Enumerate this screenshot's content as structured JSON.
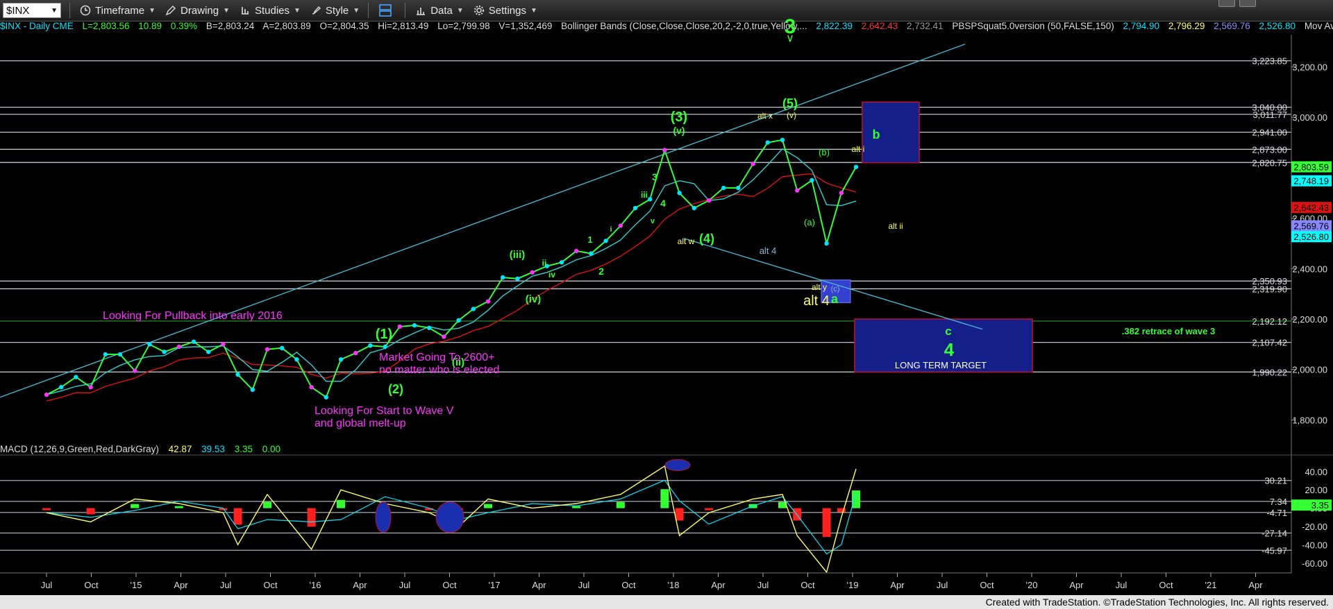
{
  "toolbar": {
    "symbol": "$INX",
    "timeframe": "Timeframe",
    "drawing": "Drawing",
    "studies": "Studies",
    "style": "Style",
    "data": "Data",
    "settings": "Settings"
  },
  "info": {
    "symbol_line": "$INX - Daily  CME",
    "last": "L=2,803.56",
    "change": "10.89",
    "pct": "0.39%",
    "bid": "B=2,803.24",
    "ask": "A=2,803.89",
    "open": "O=2,804.35",
    "high": "Hi=2,813.49",
    "low": "Lo=2,799.98",
    "volume": "V=1,352,469",
    "bb_label": "Bollinger Bands (Close,Close,Close,20,2,-2,0,true,Yellow,...",
    "bb_upper": "2,822.39",
    "bb_lower": "2,642.43",
    "bb_mid": "2,732.41",
    "pbsp_label": "PBSPSquat5.0version (50,FALSE,150)",
    "pbsp_1": "2,794.90",
    "pbsp_2": "2,796.29",
    "pbsp_3": "2,569.76",
    "pbsp_4": "2,526.80",
    "mov_av": "Mov Av..."
  },
  "macd_info": {
    "label": "MACD (12,26,9,Green,Red,DarkGray)",
    "macd": "42.87",
    "signal": "39.53",
    "hist": "3.35",
    "zero": "0.00"
  },
  "footer": "Created with TradeStation. ©TradeStation Technologies, Inc. All rights reserved.",
  "colors": {
    "price_green": "#33ff33",
    "cyan": "#00ffff",
    "red": "#d11",
    "yellow": "#ffff66",
    "magenta": "#ff33ff",
    "navy": "#000080"
  },
  "chart_data": [
    {
      "type": "line",
      "title": "$INX - Daily",
      "ylim": [
        1760,
        3300
      ],
      "y_ticks": [
        "3,200.00",
        "3,000.00",
        "2,800.00",
        "2,600.00",
        "2,400.00",
        "2,200.00",
        "2,000.00",
        "1,800.00"
      ],
      "x_ticks": [
        "Jul",
        "Oct",
        "'15",
        "Apr",
        "Jul",
        "Oct",
        "'16",
        "Apr",
        "Jul",
        "Oct",
        "'17",
        "Apr",
        "Jul",
        "Oct",
        "'18",
        "Apr",
        "Jul",
        "Oct",
        "'19",
        "Apr",
        "Jul",
        "Oct",
        "'20",
        "Apr",
        "Jul",
        "Oct",
        "'21",
        "Apr"
      ],
      "series": [
        {
          "name": "$INX",
          "x": [
            "2014-07",
            "2014-08",
            "2014-09",
            "2014-10",
            "2014-11",
            "2014-12",
            "2015-01",
            "2015-02",
            "2015-03",
            "2015-04",
            "2015-05",
            "2015-06",
            "2015-07",
            "2015-08",
            "2015-09",
            "2015-10",
            "2015-11",
            "2015-12",
            "2016-01",
            "2016-02",
            "2016-03",
            "2016-04",
            "2016-05",
            "2016-06",
            "2016-07",
            "2016-08",
            "2016-09",
            "2016-10",
            "2016-11",
            "2016-12",
            "2017-01",
            "2017-02",
            "2017-03",
            "2017-04",
            "2017-05",
            "2017-06",
            "2017-07",
            "2017-08",
            "2017-09",
            "2017-10",
            "2017-11",
            "2017-12",
            "2018-01",
            "2018-02",
            "2018-03",
            "2018-04",
            "2018-05",
            "2018-06",
            "2018-07",
            "2018-08",
            "2018-09",
            "2018-10",
            "2018-11",
            "2018-12",
            "2019-01",
            "2019-02"
          ],
          "values": [
            1900,
            1930,
            1970,
            1930,
            2060,
            2060,
            1995,
            2100,
            2070,
            2090,
            2110,
            2070,
            2100,
            1980,
            1920,
            2080,
            2085,
            2040,
            1930,
            1890,
            2040,
            2065,
            2095,
            2090,
            2170,
            2175,
            2165,
            2130,
            2195,
            2240,
            2270,
            2365,
            2360,
            2385,
            2410,
            2425,
            2470,
            2460,
            2510,
            2570,
            2640,
            2675,
            2870,
            2700,
            2640,
            2670,
            2720,
            2720,
            2815,
            2900,
            2910,
            2710,
            2750,
            2500,
            2700,
            2803
          ]
        }
      ],
      "horizontal_levels": [
        "3,223.85",
        "3,040.00",
        "3,011.77",
        "2,941.00",
        "2,873.00",
        "2,820.75",
        "2,350.93",
        "2,319.90",
        "2,192.12",
        "2,107.42",
        "1,990.22"
      ],
      "right_labels": [
        {
          "text": "2,803.59",
          "color": "#33ff33"
        },
        {
          "text": "2,748.19",
          "color": "#00ffff"
        },
        {
          "text": "2,642.43",
          "color": "#d11"
        },
        {
          "text": "2,569.76",
          "color": "#8888ff"
        },
        {
          "text": "2,526.80",
          "color": "#00ffff"
        }
      ],
      "annotations": [
        {
          "text": "3",
          "color": "#33ff33"
        },
        {
          "text": "(5)",
          "color": "#33ff33"
        },
        {
          "text": "(3)",
          "color": "#33ff33"
        },
        {
          "text": "(v)",
          "color": "#33ff33"
        },
        {
          "text": "(v)",
          "color": "#ffff66"
        },
        {
          "text": "alt x",
          "color": "#ffff66"
        },
        {
          "text": "(4)",
          "color": "#33ff33"
        },
        {
          "text": "alt w",
          "color": "#ffff66"
        },
        {
          "text": "alt 4",
          "color": "#8fb6d9"
        },
        {
          "text": "alt y",
          "color": "#ffff66"
        },
        {
          "text": "alt 4",
          "color": "#ffff66"
        },
        {
          "text": "a",
          "color": "#33ff33"
        },
        {
          "text": "(c)",
          "color": "#8fb6d9"
        },
        {
          "text": "(a)",
          "color": "#33ff33"
        },
        {
          "text": "(b)",
          "color": "#33ff33"
        },
        {
          "text": "alt i",
          "color": "#ffff66"
        },
        {
          "text": "alt ii",
          "color": "#ffff66"
        },
        {
          "text": "b",
          "color": "#33ff33"
        },
        {
          "text": "c",
          "color": "#33ff33"
        },
        {
          "text": "4",
          "color": "#33ff33"
        },
        {
          "text": "LONG TERM TARGET",
          "color": "#ffffff"
        },
        {
          "text": ".382 retrace of wave 3",
          "color": "#33ff33"
        },
        {
          "text": "(1)",
          "color": "#33ff33"
        },
        {
          "text": "(2)",
          "color": "#33ff33"
        },
        {
          "text": "(ii)",
          "color": "#33ff33"
        },
        {
          "text": "(iii)",
          "color": "#33ff33"
        },
        {
          "text": "(iv)",
          "color": "#33ff33"
        },
        {
          "text": "1",
          "color": "#33ff33"
        },
        {
          "text": "2",
          "color": "#33ff33"
        },
        {
          "text": "3",
          "color": "#33ff33"
        },
        {
          "text": "4",
          "color": "#33ff33"
        },
        {
          "text": "iii",
          "color": "#33ff33"
        },
        {
          "text": "i",
          "color": "#33ff33"
        },
        {
          "text": "ii",
          "color": "#33ff33"
        },
        {
          "text": "iv",
          "color": "#33ff33"
        },
        {
          "text": "v",
          "color": "#33ff33"
        },
        {
          "text": "Looking For Pullback into early 2016",
          "color": "#ff33ff"
        },
        {
          "text": "Market Going To 2600+",
          "color": "#ff33ff"
        },
        {
          "text": "no matter who is elected",
          "color": "#ff33ff"
        },
        {
          "text": "Looking For Start to Wave V",
          "color": "#ff33ff"
        },
        {
          "text": "and global melt-up",
          "color": "#ff33ff"
        }
      ]
    },
    {
      "type": "line",
      "title": "MACD (12,26,9,Green,Red,DarkGray)",
      "ylim": [
        -70,
        55
      ],
      "y_ticks": [
        "40.00",
        "20.00",
        "0.00",
        "-20.00",
        "-40.00",
        "-60.00"
      ],
      "horizontal_levels": [
        "30.21",
        "7.34",
        "-4.71",
        "-27.14",
        "-45.97"
      ],
      "series": [
        {
          "name": "MACD",
          "x": [
            "2014-07",
            "2014-10",
            "2015-01",
            "2015-04",
            "2015-07",
            "2015-08",
            "2015-10",
            "2016-01",
            "2016-03",
            "2016-06",
            "2016-09",
            "2016-11",
            "2017-01",
            "2017-04",
            "2017-07",
            "2017-10",
            "2018-01",
            "2018-02",
            "2018-04",
            "2018-07",
            "2018-09",
            "2018-10",
            "2018-12",
            "2019-01",
            "2019-02"
          ],
          "values": [
            -5,
            -15,
            10,
            5,
            -5,
            -40,
            15,
            -45,
            20,
            5,
            -5,
            -20,
            10,
            0,
            5,
            15,
            46,
            -30,
            -5,
            10,
            15,
            -30,
            -70,
            -10,
            42.87
          ]
        }
      ],
      "right_labels": [
        {
          "text": "3.35",
          "color": "#33ff33"
        }
      ]
    }
  ]
}
